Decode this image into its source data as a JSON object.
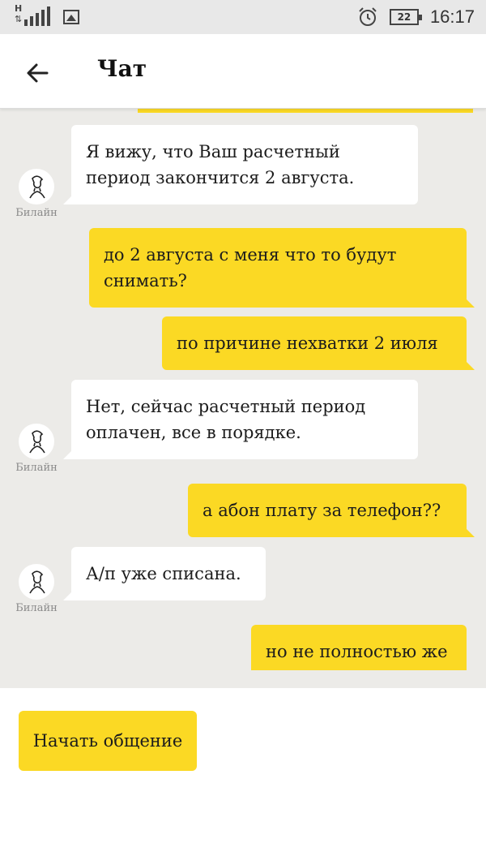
{
  "status_bar": {
    "network_type": "H",
    "battery_level": "22",
    "time": "16:17",
    "icons": [
      "signal-icon",
      "image-icon",
      "alarm-icon",
      "battery-icon"
    ]
  },
  "header": {
    "back_icon": "arrow-left-icon",
    "title": "Чат"
  },
  "colors": {
    "accent": "#fbd924",
    "chat_background": "#ecebe8",
    "bot_bubble": "#ffffff",
    "status_bar": "#e8e8e8"
  },
  "messages": [
    {
      "from": "bot",
      "sender": "Билайн",
      "text": "Я вижу, что Ваш расчетный период закончится 2 августа."
    },
    {
      "from": "user",
      "text": "до 2 августа с меня что то будут снимать?"
    },
    {
      "from": "user",
      "text": "по причине нехватки 2 июля"
    },
    {
      "from": "bot",
      "sender": "Билайн",
      "text": "Нет, сейчас расчетный период оплачен, все в порядке."
    },
    {
      "from": "user",
      "text": "а абон плату за телефон??"
    },
    {
      "from": "bot",
      "sender": "Билайн",
      "text": "А/п уже списана."
    },
    {
      "from": "user",
      "text": "но не полностью же"
    }
  ],
  "actions": {
    "start_chat_label": "Начать общение"
  }
}
